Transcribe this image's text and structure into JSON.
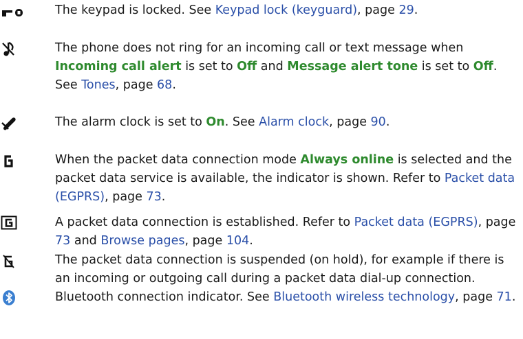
{
  "colors": {
    "text": "#1a1a1a",
    "link": "#2a4fa8",
    "option": "#2e8a2e"
  },
  "entries": [
    {
      "icon": "keypad-lock-icon",
      "segments": [
        {
          "t": "The keypad is locked. See "
        },
        {
          "t": "Keypad lock (keyguard)",
          "k": "link"
        },
        {
          "t": ", page "
        },
        {
          "t": "29",
          "k": "link"
        },
        {
          "t": "."
        }
      ]
    },
    {
      "icon": "silent-icon",
      "segments": [
        {
          "t": "The phone does not ring for an incoming call or text message when "
        },
        {
          "t": "Incoming call alert",
          "k": "opt"
        },
        {
          "t": " is set to "
        },
        {
          "t": "Off",
          "k": "opt"
        },
        {
          "t": " and "
        },
        {
          "t": "Message alert tone",
          "k": "opt"
        },
        {
          "t": " is set to "
        },
        {
          "t": "Off",
          "k": "opt"
        },
        {
          "t": ". See "
        },
        {
          "t": "Tones",
          "k": "link"
        },
        {
          "t": ", page "
        },
        {
          "t": "68",
          "k": "link"
        },
        {
          "t": "."
        }
      ]
    },
    {
      "icon": "alarm-bell-icon",
      "segments": [
        {
          "t": "The alarm clock is set to "
        },
        {
          "t": "On",
          "k": "opt"
        },
        {
          "t": ". See "
        },
        {
          "t": "Alarm clock",
          "k": "link"
        },
        {
          "t": ", page "
        },
        {
          "t": "90",
          "k": "link"
        },
        {
          "t": "."
        }
      ]
    },
    {
      "icon": "packet-data-available-icon",
      "segments": [
        {
          "t": "When the packet data connection mode "
        },
        {
          "t": "Always online",
          "k": "opt"
        },
        {
          "t": " is selected and the packet data service is available, the indicator is shown. Refer to "
        },
        {
          "t": "Packet data (EGPRS)",
          "k": "link"
        },
        {
          "t": ", page "
        },
        {
          "t": "73",
          "k": "link"
        },
        {
          "t": "."
        }
      ]
    },
    {
      "icon": "packet-data-established-icon",
      "segments": [
        {
          "t": "A packet data connection is established. Refer to "
        },
        {
          "t": "Packet data (EGPRS)",
          "k": "link"
        },
        {
          "t": ", page "
        },
        {
          "t": "73",
          "k": "link"
        },
        {
          "t": " and "
        },
        {
          "t": "Browse pages",
          "k": "link"
        },
        {
          "t": ", page "
        },
        {
          "t": "104",
          "k": "link"
        },
        {
          "t": "."
        }
      ]
    },
    {
      "icon": "packet-data-suspended-icon",
      "segments": [
        {
          "t": "The packet data connection is suspended (on hold), for example if there is an incoming or outgoing call during a packet data dial-up connection."
        }
      ]
    },
    {
      "icon": "bluetooth-icon",
      "segments": [
        {
          "t": "Bluetooth connection indicator. See "
        },
        {
          "t": "Bluetooth wireless technology",
          "k": "link"
        },
        {
          "t": ", page "
        },
        {
          "t": "71",
          "k": "link"
        },
        {
          "t": "."
        }
      ]
    }
  ]
}
